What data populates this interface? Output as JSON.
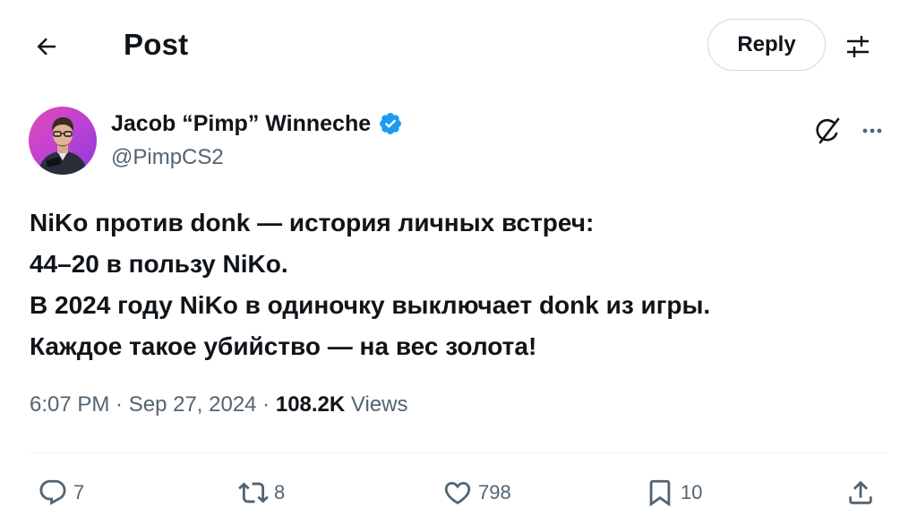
{
  "header": {
    "title": "Post",
    "reply_label": "Reply",
    "back_icon": "arrow-left-icon",
    "settings_icon": "sliders-icon"
  },
  "author": {
    "name": "Jacob “Pimp” Winneche",
    "handle": "@PimpCS2",
    "verified": true,
    "verified_color": "#1d9bf0"
  },
  "tweet": {
    "lines": [
      "NiKo против donk — история личных встреч:",
      "44–20 в пользу NiKo.",
      "В 2024 году NiKo в одиночку выключает donk из игры.",
      "Каждое такое убийство — на вес золота!"
    ]
  },
  "meta": {
    "time": "6:07 PM",
    "date": "Sep 27, 2024",
    "views_count": "108.2K",
    "views_label": "Views",
    "separator": " · "
  },
  "actions": {
    "replies": "7",
    "reposts": "8",
    "likes": "798",
    "bookmarks": "10"
  },
  "colors": {
    "text": "#0f1419",
    "secondary": "#536471",
    "border": "#cfd9de",
    "accent": "#1d9bf0"
  }
}
